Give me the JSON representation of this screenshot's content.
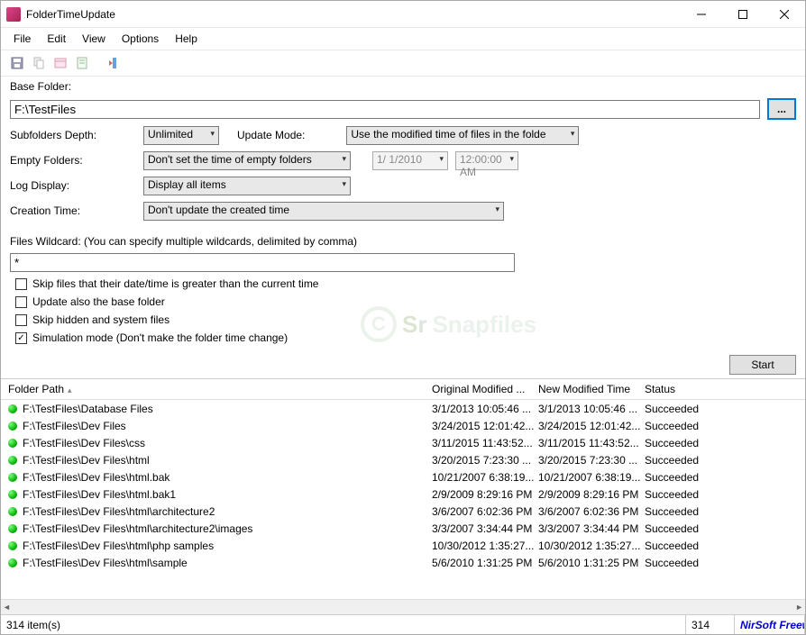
{
  "window": {
    "title": "FolderTimeUpdate"
  },
  "menu": {
    "file": "File",
    "edit": "Edit",
    "view": "View",
    "options": "Options",
    "help": "Help"
  },
  "labels": {
    "base_folder": "Base Folder:",
    "subfolders_depth": "Subfolders Depth:",
    "update_mode": "Update Mode:",
    "empty_folders": "Empty Folders:",
    "log_display": "Log Display:",
    "creation_time": "Creation Time:",
    "wildcard": "Files Wildcard: (You can specify multiple wildcards, delimited by comma)",
    "start": "Start",
    "browse": "..."
  },
  "values": {
    "base_folder": "F:\\TestFiles",
    "subfolders_depth": "Unlimited",
    "update_mode": "Use the modified time of files in the folde",
    "empty_folders": "Don't set the time of empty folders",
    "date": "1/ 1/2010",
    "time": "12:00:00 AM",
    "log_display": "Display all items",
    "creation_time": "Don't update the created time",
    "wildcard": "*"
  },
  "checkboxes": {
    "skip_future": {
      "label": "Skip files that their date/time is greater than the current time",
      "checked": false
    },
    "update_base": {
      "label": "Update also the base folder",
      "checked": false
    },
    "skip_hidden": {
      "label": "Skip hidden and system files",
      "checked": false
    },
    "simulation": {
      "label": "Simulation mode (Don't make the folder time change)",
      "checked": true
    }
  },
  "columns": {
    "path": "Folder Path",
    "orig": "Original Modified ...",
    "newt": "New Modified Time",
    "stat": "Status"
  },
  "rows": [
    {
      "path": "F:\\TestFiles\\Database Files",
      "orig": "3/1/2013 10:05:46 ...",
      "newt": "3/1/2013 10:05:46 ...",
      "stat": "Succeeded"
    },
    {
      "path": "F:\\TestFiles\\Dev Files",
      "orig": "3/24/2015 12:01:42...",
      "newt": "3/24/2015 12:01:42...",
      "stat": "Succeeded"
    },
    {
      "path": "F:\\TestFiles\\Dev Files\\css",
      "orig": "3/11/2015 11:43:52...",
      "newt": "3/11/2015 11:43:52...",
      "stat": "Succeeded"
    },
    {
      "path": "F:\\TestFiles\\Dev Files\\html",
      "orig": "3/20/2015 7:23:30 ...",
      "newt": "3/20/2015 7:23:30 ...",
      "stat": "Succeeded"
    },
    {
      "path": "F:\\TestFiles\\Dev Files\\html.bak",
      "orig": "10/21/2007 6:38:19...",
      "newt": "10/21/2007 6:38:19...",
      "stat": "Succeeded"
    },
    {
      "path": "F:\\TestFiles\\Dev Files\\html.bak1",
      "orig": "2/9/2009 8:29:16 PM",
      "newt": "2/9/2009 8:29:16 PM",
      "stat": "Succeeded"
    },
    {
      "path": "F:\\TestFiles\\Dev Files\\html\\architecture2",
      "orig": "3/6/2007 6:02:36 PM",
      "newt": "3/6/2007 6:02:36 PM",
      "stat": "Succeeded"
    },
    {
      "path": "F:\\TestFiles\\Dev Files\\html\\architecture2\\images",
      "orig": "3/3/2007 3:34:44 PM",
      "newt": "3/3/2007 3:34:44 PM",
      "stat": "Succeeded"
    },
    {
      "path": "F:\\TestFiles\\Dev Files\\html\\php samples",
      "orig": "10/30/2012 1:35:27...",
      "newt": "10/30/2012 1:35:27...",
      "stat": "Succeeded"
    },
    {
      "path": "F:\\TestFiles\\Dev Files\\html\\sample",
      "orig": "5/6/2010 1:31:25 PM",
      "newt": "5/6/2010 1:31:25 PM",
      "stat": "Succeeded"
    }
  ],
  "status": {
    "items": "314 item(s)",
    "count": "314",
    "link": "NirSoft Freeware. http"
  },
  "watermark": {
    "text": "Snapfiles",
    "c": "C"
  }
}
